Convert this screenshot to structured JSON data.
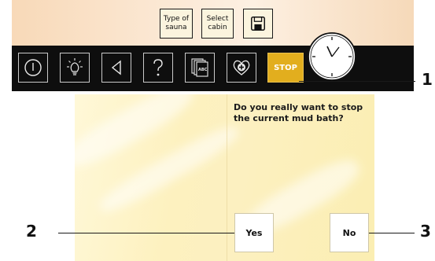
{
  "top_bar": {
    "type_of_sauna_label": "Type of sauna",
    "select_cabin_label": "Select cabin"
  },
  "toolbar": {
    "stop_label": "STOP",
    "items": [
      {
        "icon": "power-icon"
      },
      {
        "icon": "light-bulb-icon"
      },
      {
        "icon": "back-arrow-icon"
      },
      {
        "icon": "help-icon"
      },
      {
        "icon": "documents-abc-icon",
        "text": "ABC"
      },
      {
        "icon": "heart-plus-icon"
      }
    ]
  },
  "dialog": {
    "question": "Do you really want to stop the current mud bath?",
    "yes_label": "Yes",
    "no_label": "No"
  },
  "callouts": {
    "one": "1",
    "two": "2",
    "three": "3"
  },
  "colors": {
    "stop_button": "#e2ae1e",
    "toolbar_bg": "#0e0e0e",
    "panel_bg": "#fdf1bf"
  }
}
